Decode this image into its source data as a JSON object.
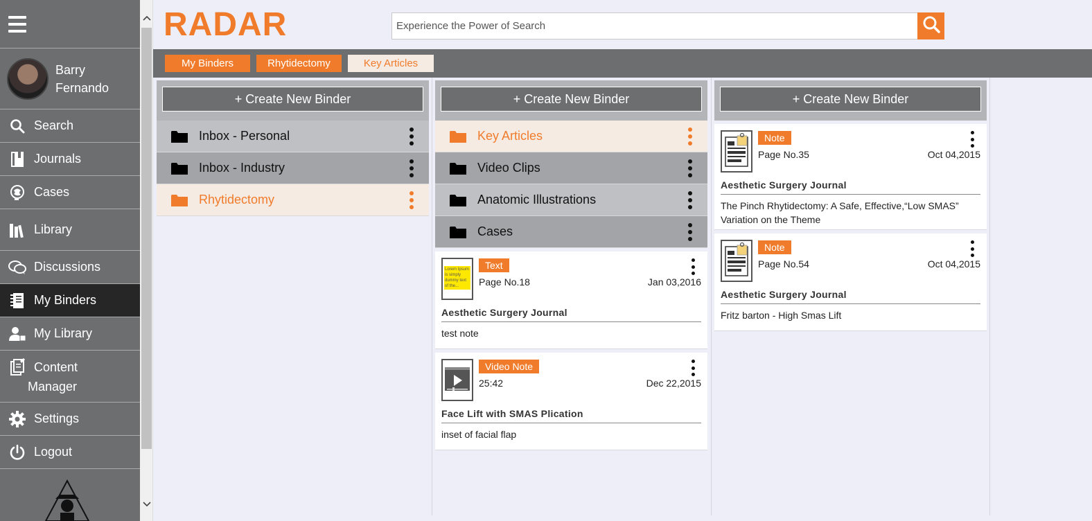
{
  "app": {
    "logo": "RADAR"
  },
  "search": {
    "placeholder": "Experience the Power of Search"
  },
  "sidebar": {
    "user_name_line1": "Barry",
    "user_name_line2": "Fernando",
    "items": [
      {
        "label": "Search",
        "icon": "search-icon"
      },
      {
        "label": "Journals",
        "icon": "journal-icon"
      },
      {
        "label": "Cases",
        "icon": "brain-head-icon"
      },
      {
        "label": "Library",
        "icon": "books-icon"
      },
      {
        "label": "Discussions",
        "icon": "chat-bubbles-icon"
      },
      {
        "label": "My Binders",
        "icon": "binder-icon",
        "active": true
      },
      {
        "label": "My Library",
        "icon": "user-book-icon"
      },
      {
        "label_line1": "Content",
        "label_line2": "Manager",
        "icon": "content-edit-icon"
      },
      {
        "label": "Settings",
        "icon": "gear-icon"
      },
      {
        "label": "Logout",
        "icon": "power-icon"
      }
    ]
  },
  "breadcrumb": [
    "My Binders",
    "Rhytidectomy",
    "Key Articles"
  ],
  "columns": [
    {
      "create_label": "+ Create New Binder",
      "folders": [
        "Inbox - Personal",
        "Inbox - Industry",
        "Rhytidectomy"
      ]
    },
    {
      "create_label": "+ Create New Binder",
      "folders": [
        "Key Articles",
        "Video Clips",
        "Anatomic Illustrations",
        "Cases"
      ],
      "cards": [
        {
          "tag": "Text",
          "meta_left": "Page No.18",
          "date": "Jan 03,2016",
          "journal": "Aesthetic Surgery Journal",
          "note": "test note",
          "thumb_text": "Lorem Ipsum is simply dummy text of the..."
        },
        {
          "tag": "Video Note",
          "meta_left": "25:42",
          "date": "Dec 22,2015",
          "journal": "Face Lift with SMAS Plication",
          "note": "inset of facial flap"
        }
      ]
    },
    {
      "create_label": "+ Create New Binder",
      "cards": [
        {
          "tag": "Note",
          "meta_left": "Page No.35",
          "date": "Oct 04,2015",
          "journal": "Aesthetic Surgery Journal",
          "note": "The Pinch Rhytidectomy: A Safe, Effective,“Low SMAS” Variation on the Theme"
        },
        {
          "tag": "Note",
          "meta_left": "Page No.54",
          "date": "Oct 04,2015",
          "journal": "Aesthetic Surgery Journal",
          "note": "Fritz barton - High Smas Lift"
        }
      ]
    }
  ],
  "colors": {
    "accent": "#f07c2b",
    "sidebar": "#6c6e70",
    "active_nav": "#262626",
    "active_row": "#f6ebe3"
  }
}
